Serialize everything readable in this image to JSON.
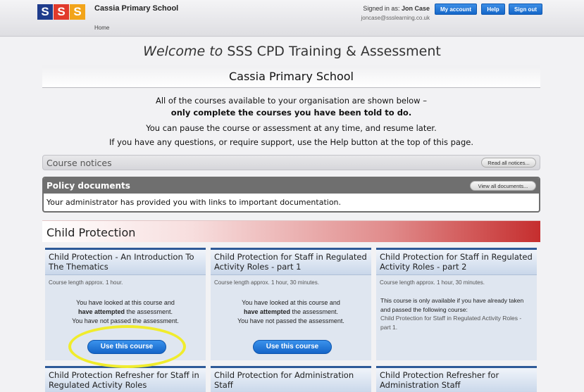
{
  "header": {
    "logo_letters": [
      "S",
      "S",
      "S"
    ],
    "school_name": "Cassia Primary School",
    "breadcrumb_home": "Home",
    "signed_in_prefix": "Signed in as:",
    "signed_in_user": "Jon Case",
    "user_email": "joncase@ssslearning.co.uk",
    "buttons": {
      "my_account": "My account",
      "help": "Help",
      "sign_out": "Sign out"
    }
  },
  "welcome": {
    "prefix": "Welcome to",
    "title": "SSS CPD Training & Assessment"
  },
  "organisation_title": "Cassia Primary School",
  "intro": {
    "line1": "All of the courses available to your organisation are shown below –",
    "line2": "only complete the courses you have been told to do.",
    "line3": "You can pause the course or assessment at any time, and resume later.",
    "line4": "If you have any questions, or require support, use the Help button at the top of this page."
  },
  "notices": {
    "title": "Course notices",
    "button": "Read all notices..."
  },
  "policy": {
    "title": "Policy documents",
    "button": "View all documents...",
    "text": "Your administrator has provided you with links to important documentation."
  },
  "category": {
    "title": "Child Protection"
  },
  "courses": [
    {
      "title": "Child Protection - An Introduction To The Thematics",
      "length": "Course length approx. 1 hour.",
      "status1": "You have looked at this course and",
      "status2_bold": "have attempted",
      "status2_rest": " the assessment.",
      "status3": "You have not passed the assessment.",
      "button": "Use this course"
    },
    {
      "title": "Child Protection for Staff in Regulated Activity Roles - part 1",
      "length": "Course length approx. 1 hour, 30 minutes.",
      "status1": "You have looked at this course and",
      "status2_bold": "have attempted",
      "status2_rest": " the assessment.",
      "status3": "You have not passed the assessment.",
      "button": "Use this course"
    },
    {
      "title": "Child Protection for Staff in Regulated Activity Roles - part 2",
      "length": "Course length approx. 1 hour, 30 minutes.",
      "note": "This course is only available if you have already taken and passed the following course:",
      "prerequisite": "Child Protection for Staff in Regulated Activity Roles - part 1."
    },
    {
      "title": "Child Protection Refresher for Staff in Regulated Activity Roles"
    },
    {
      "title": "Child Protection for Administration Staff"
    },
    {
      "title": "Child Protection Refresher for Administration Staff"
    }
  ],
  "colors": {
    "accent_blue": "#1567c9",
    "card_border": "#2e5a98",
    "category_red": "#c52e2e",
    "highlight_yellow": "#f0ec2c",
    "logo_blue": "#1f3c8c",
    "logo_red": "#e13a2b",
    "logo_orange": "#f2a41a"
  }
}
